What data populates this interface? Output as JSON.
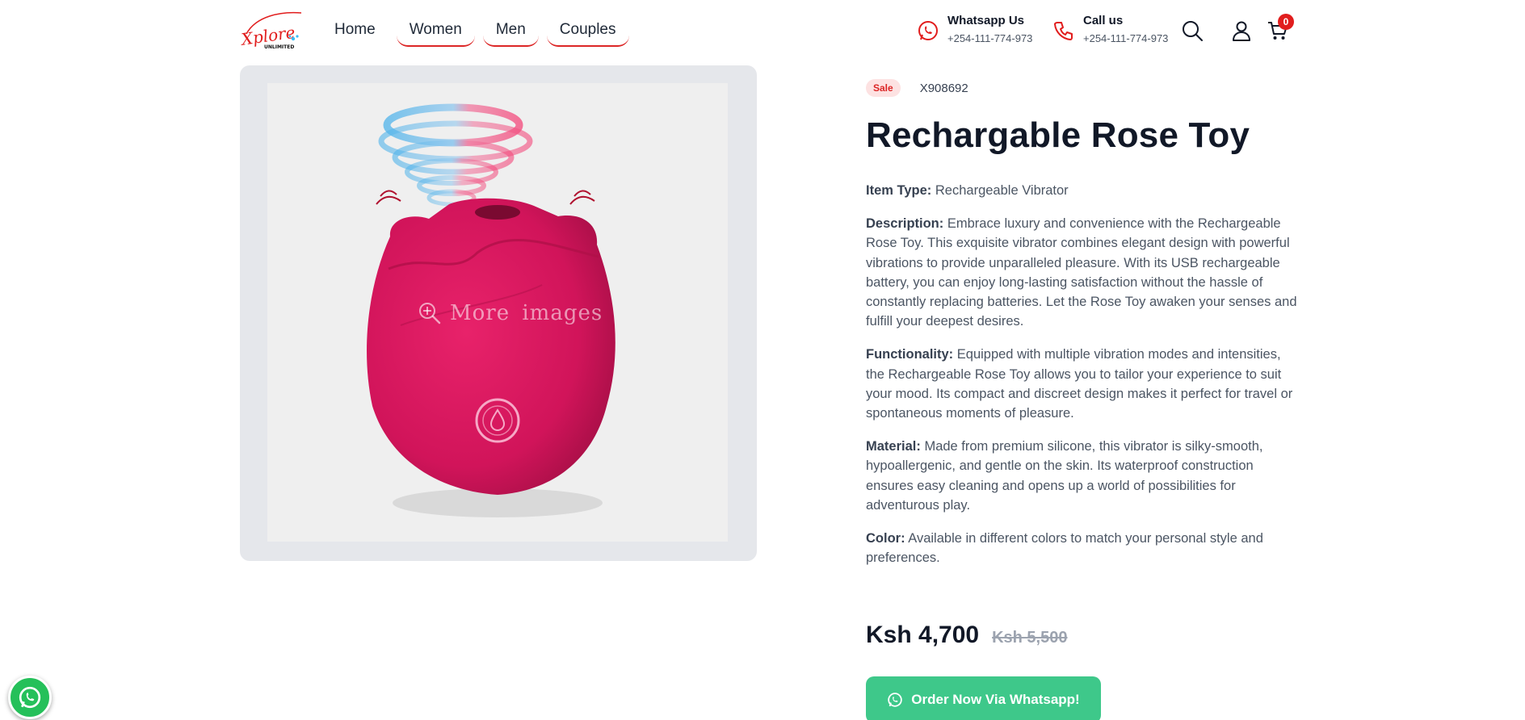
{
  "brand": {
    "logo_text": "Xplore",
    "logo_subtext": "UNLIMITED"
  },
  "nav": {
    "items": [
      {
        "label": "Home"
      },
      {
        "label": "Women"
      },
      {
        "label": "Men"
      },
      {
        "label": "Couples"
      }
    ]
  },
  "contacts": {
    "whatsapp": {
      "title": "Whatsapp Us",
      "number": "+254-111-774-973",
      "icon": "whatsapp-icon"
    },
    "call": {
      "title": "Call us",
      "number": "+254-111-774-973",
      "icon": "phone-icon"
    }
  },
  "header_icons": [
    "search-icon",
    "user-icon",
    "cart-icon"
  ],
  "cart": {
    "count": "0"
  },
  "gallery": {
    "overlay_label": "More images"
  },
  "product": {
    "badge": "Sale",
    "sku": "X908692",
    "title": "Rechargable Rose Toy",
    "details": [
      {
        "label": "Item Type:",
        "text": " Rechargeable Vibrator"
      },
      {
        "label": "Description:",
        "text": " Embrace luxury and convenience with the Rechargeable Rose Toy. This exquisite vibrator combines elegant design with powerful vibrations to provide unparalleled pleasure. With its USB rechargeable battery, you can enjoy long-lasting satisfaction without the hassle of constantly replacing batteries. Let the Rose Toy awaken your senses and fulfill your deepest desires."
      },
      {
        "label": "Functionality:",
        "text": " Equipped with multiple vibration modes and intensities, the Rechargeable Rose Toy allows you to tailor your experience to suit your mood. Its compact and discreet design makes it perfect for travel or spontaneous moments of pleasure."
      },
      {
        "label": "Material:",
        "text": " Made from premium silicone, this vibrator is silky-smooth, hypoallergenic, and gentle on the skin. Its waterproof construction ensures easy cleaning and opens up a world of possibilities for adventurous play."
      },
      {
        "label": "Color:",
        "text": " Available in different colors to match your personal style and preferences."
      }
    ],
    "price": "Ksh 4,700",
    "old_price": "Ksh 5,500",
    "order_button": "Order Now Via Whatsapp!"
  },
  "colors": {
    "accent_red": "#dc2626",
    "whatsapp_green": "#3ec88a",
    "product_pink": "#d8145a"
  }
}
